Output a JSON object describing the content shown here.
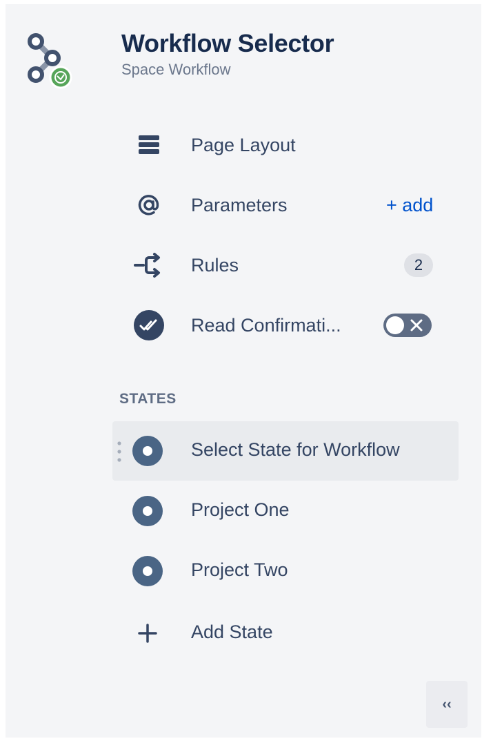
{
  "header": {
    "title": "Workflow Selector",
    "subtitle": "Space Workflow",
    "logo_icon": "workflow-logo-icon"
  },
  "menu": {
    "page_layout": {
      "label": "Page Layout",
      "icon": "layout-icon"
    },
    "parameters": {
      "label": "Parameters",
      "icon": "at-sign-icon",
      "action": "+ add"
    },
    "rules": {
      "label": "Rules",
      "icon": "rules-branch-icon",
      "count": "2"
    },
    "read_confirmation": {
      "label": "Read Confirmati...",
      "icon": "double-check-icon",
      "enabled": false
    }
  },
  "states": {
    "heading": "STATES",
    "items": [
      {
        "label": "Select State for Workflow",
        "selected": true
      },
      {
        "label": "Project One",
        "selected": false
      },
      {
        "label": "Project Two",
        "selected": false
      }
    ],
    "add_label": "Add State"
  },
  "collapse": {
    "label": "‹‹"
  },
  "colors": {
    "title": "#172b4d",
    "text": "#344563",
    "muted": "#6b778c",
    "link": "#0052cc",
    "icon": "#42526e",
    "state_icon": "#4a6585",
    "logo_green": "#57a55a",
    "panel_bg": "#f4f5f7",
    "selected_bg": "#e9ebee"
  }
}
